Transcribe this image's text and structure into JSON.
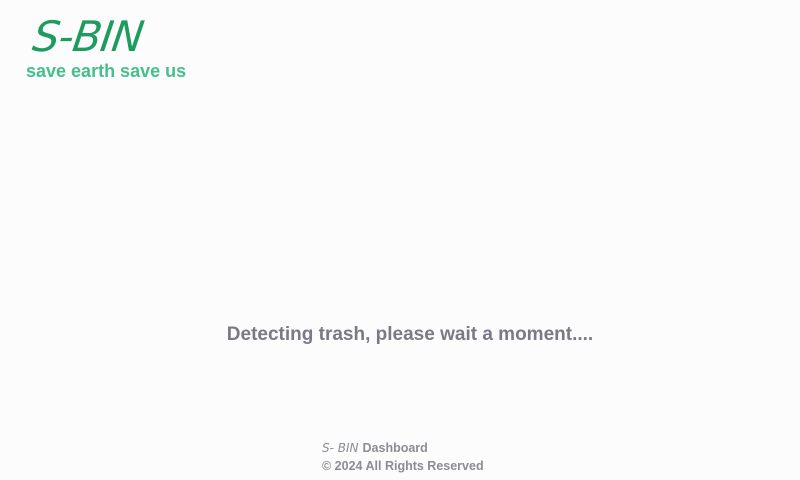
{
  "brand": {
    "logo_text": "S-BIN",
    "tagline": "save earth save us"
  },
  "status": {
    "message": "Detecting trash, please wait a moment...."
  },
  "footer": {
    "logo_text": "S- BIN",
    "title": "Dashboard",
    "copyright": "© 2024 All Rights Reserved"
  },
  "colors": {
    "brand_green": "#1e9b5e",
    "tagline_green": "#45bf8e",
    "text_gray": "#7a7a85",
    "background": "#fcfcfc"
  }
}
